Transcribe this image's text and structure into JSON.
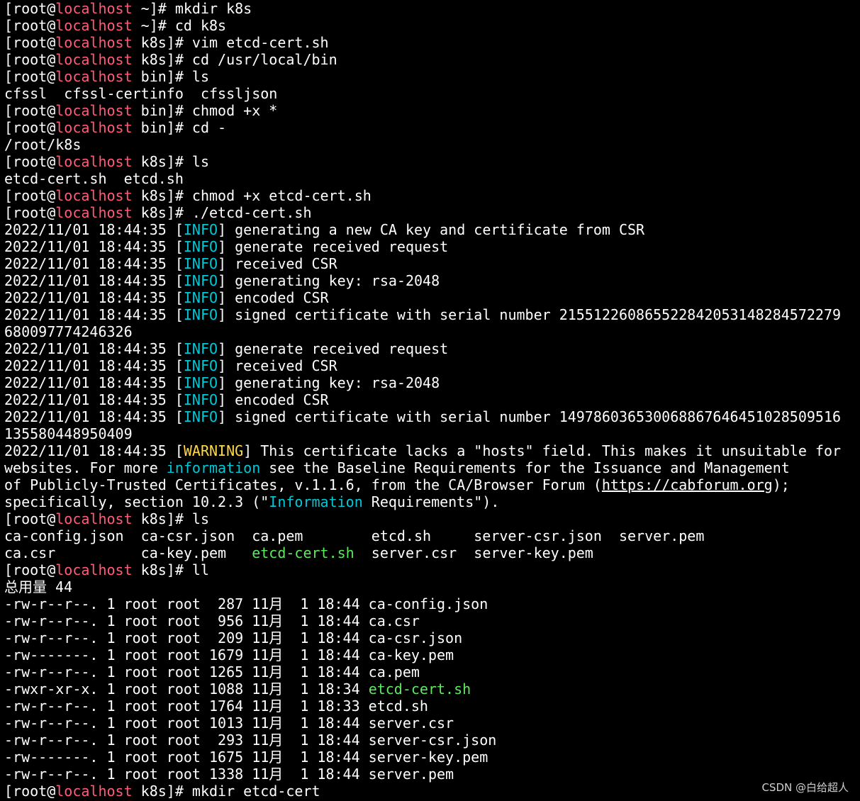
{
  "colors": {
    "background": "#000000",
    "text": "#ffffff",
    "hostname": "#ff5c7a",
    "info_tag": "#00c8d7",
    "warning_tag": "#ffd84a",
    "executable": "#5ee85e"
  },
  "terminal": {
    "lines": [
      {
        "segments": [
          {
            "t": "[root@"
          },
          {
            "t": "localhost",
            "c": "host"
          },
          {
            "t": " ~]# mkdir k8s"
          }
        ]
      },
      {
        "segments": [
          {
            "t": "[root@"
          },
          {
            "t": "localhost",
            "c": "host"
          },
          {
            "t": " ~]# cd k8s"
          }
        ]
      },
      {
        "segments": [
          {
            "t": "[root@"
          },
          {
            "t": "localhost",
            "c": "host"
          },
          {
            "t": " k8s]# vim etcd-cert.sh"
          }
        ]
      },
      {
        "segments": [
          {
            "t": "[root@"
          },
          {
            "t": "localhost",
            "c": "host"
          },
          {
            "t": " k8s]# cd /usr/local/bin"
          }
        ]
      },
      {
        "segments": [
          {
            "t": "[root@"
          },
          {
            "t": "localhost",
            "c": "host"
          },
          {
            "t": " bin]# ls"
          }
        ]
      },
      {
        "segments": [
          {
            "t": "cfssl  cfssl-certinfo  cfssljson"
          }
        ]
      },
      {
        "segments": [
          {
            "t": "[root@"
          },
          {
            "t": "localhost",
            "c": "host"
          },
          {
            "t": " bin]# chmod +x *"
          }
        ]
      },
      {
        "segments": [
          {
            "t": "[root@"
          },
          {
            "t": "localhost",
            "c": "host"
          },
          {
            "t": " bin]# cd -"
          }
        ]
      },
      {
        "segments": [
          {
            "t": "/root/k8s"
          }
        ]
      },
      {
        "segments": [
          {
            "t": "[root@"
          },
          {
            "t": "localhost",
            "c": "host"
          },
          {
            "t": " k8s]# ls"
          }
        ]
      },
      {
        "segments": [
          {
            "t": "etcd-cert.sh  etcd.sh"
          }
        ]
      },
      {
        "segments": [
          {
            "t": "[root@"
          },
          {
            "t": "localhost",
            "c": "host"
          },
          {
            "t": " k8s]# chmod +x etcd-cert.sh"
          }
        ]
      },
      {
        "segments": [
          {
            "t": "[root@"
          },
          {
            "t": "localhost",
            "c": "host"
          },
          {
            "t": " k8s]# ./etcd-cert.sh"
          }
        ]
      },
      {
        "segments": [
          {
            "t": "2022/11/01 18:44:35 ["
          },
          {
            "t": "INFO",
            "c": "info"
          },
          {
            "t": "] generating a new CA key and certificate from CSR"
          }
        ]
      },
      {
        "segments": [
          {
            "t": "2022/11/01 18:44:35 ["
          },
          {
            "t": "INFO",
            "c": "info"
          },
          {
            "t": "] generate received request"
          }
        ]
      },
      {
        "segments": [
          {
            "t": "2022/11/01 18:44:35 ["
          },
          {
            "t": "INFO",
            "c": "info"
          },
          {
            "t": "] received CSR"
          }
        ]
      },
      {
        "segments": [
          {
            "t": "2022/11/01 18:44:35 ["
          },
          {
            "t": "INFO",
            "c": "info"
          },
          {
            "t": "] generating key: rsa-2048"
          }
        ]
      },
      {
        "segments": [
          {
            "t": "2022/11/01 18:44:35 ["
          },
          {
            "t": "INFO",
            "c": "info"
          },
          {
            "t": "] encoded CSR"
          }
        ]
      },
      {
        "segments": [
          {
            "t": "2022/11/01 18:44:35 ["
          },
          {
            "t": "INFO",
            "c": "info"
          },
          {
            "t": "] signed certificate with serial number 215512260865522842053148284572279"
          }
        ]
      },
      {
        "segments": [
          {
            "t": "680097774246326"
          }
        ]
      },
      {
        "segments": [
          {
            "t": "2022/11/01 18:44:35 ["
          },
          {
            "t": "INFO",
            "c": "info"
          },
          {
            "t": "] generate received request"
          }
        ]
      },
      {
        "segments": [
          {
            "t": "2022/11/01 18:44:35 ["
          },
          {
            "t": "INFO",
            "c": "info"
          },
          {
            "t": "] received CSR"
          }
        ]
      },
      {
        "segments": [
          {
            "t": "2022/11/01 18:44:35 ["
          },
          {
            "t": "INFO",
            "c": "info"
          },
          {
            "t": "] generating key: rsa-2048"
          }
        ]
      },
      {
        "segments": [
          {
            "t": "2022/11/01 18:44:35 ["
          },
          {
            "t": "INFO",
            "c": "info"
          },
          {
            "t": "] encoded CSR"
          }
        ]
      },
      {
        "segments": [
          {
            "t": "2022/11/01 18:44:35 ["
          },
          {
            "t": "INFO",
            "c": "info"
          },
          {
            "t": "] signed certificate with serial number 149786036530068867646451028509516"
          }
        ]
      },
      {
        "segments": [
          {
            "t": "135580448950409"
          }
        ]
      },
      {
        "segments": [
          {
            "t": "2022/11/01 18:44:35 ["
          },
          {
            "t": "WARNING",
            "c": "warn"
          },
          {
            "t": "] This certificate lacks a \"hosts\" field. This makes it unsuitable for"
          }
        ]
      },
      {
        "segments": [
          {
            "t": "websites. For more "
          },
          {
            "t": "information",
            "c": "info"
          },
          {
            "t": " see the Baseline Requirements for the Issuance and Management"
          }
        ]
      },
      {
        "segments": [
          {
            "t": "of Publicly-Trusted Certificates, v.1.1.6, from the CA/Browser Forum ("
          },
          {
            "t": "https://cabforum.org",
            "c": "link"
          },
          {
            "t": ");"
          }
        ]
      },
      {
        "segments": [
          {
            "t": "specifically, section 10.2.3 (\""
          },
          {
            "t": "Information",
            "c": "info"
          },
          {
            "t": " Requirements\")."
          }
        ]
      },
      {
        "segments": [
          {
            "t": "[root@"
          },
          {
            "t": "localhost",
            "c": "host"
          },
          {
            "t": " k8s]# ls"
          }
        ]
      },
      {
        "segments": [
          {
            "t": "ca-config.json  ca-csr.json  ca.pem        etcd.sh     server-csr.json  server.pem"
          }
        ]
      },
      {
        "segments": [
          {
            "t": "ca.csr          ca-key.pem   "
          },
          {
            "t": "etcd-cert.sh",
            "c": "exec"
          },
          {
            "t": "  server.csr  server-key.pem"
          }
        ]
      },
      {
        "segments": [
          {
            "t": "[root@"
          },
          {
            "t": "localhost",
            "c": "host"
          },
          {
            "t": " k8s]# ll"
          }
        ]
      },
      {
        "segments": [
          {
            "t": "总用量 44"
          }
        ]
      },
      {
        "segments": [
          {
            "t": "-rw-r--r--. 1 root root  287 11月  1 18:44 ca-config.json"
          }
        ]
      },
      {
        "segments": [
          {
            "t": "-rw-r--r--. 1 root root  956 11月  1 18:44 ca.csr"
          }
        ]
      },
      {
        "segments": [
          {
            "t": "-rw-r--r--. 1 root root  209 11月  1 18:44 ca-csr.json"
          }
        ]
      },
      {
        "segments": [
          {
            "t": "-rw-------. 1 root root 1679 11月  1 18:44 ca-key.pem"
          }
        ]
      },
      {
        "segments": [
          {
            "t": "-rw-r--r--. 1 root root 1265 11月  1 18:44 ca.pem"
          }
        ]
      },
      {
        "segments": [
          {
            "t": "-rwxr-xr-x. 1 root root 1088 11月  1 18:34 "
          },
          {
            "t": "etcd-cert.sh",
            "c": "exec"
          }
        ]
      },
      {
        "segments": [
          {
            "t": "-rw-r--r--. 1 root root 1764 11月  1 18:33 etcd.sh"
          }
        ]
      },
      {
        "segments": [
          {
            "t": "-rw-r--r--. 1 root root 1013 11月  1 18:44 server.csr"
          }
        ]
      },
      {
        "segments": [
          {
            "t": "-rw-r--r--. 1 root root  293 11月  1 18:44 server-csr.json"
          }
        ]
      },
      {
        "segments": [
          {
            "t": "-rw-------. 1 root root 1675 11月  1 18:44 server-key.pem"
          }
        ]
      },
      {
        "segments": [
          {
            "t": "-rw-r--r--. 1 root root 1338 11月  1 18:44 server.pem"
          }
        ]
      },
      {
        "segments": [
          {
            "t": "[root@"
          },
          {
            "t": "localhost",
            "c": "host"
          },
          {
            "t": " k8s]# mkdir etcd-cert"
          }
        ]
      }
    ]
  },
  "watermark": "CSDN @白给超人"
}
